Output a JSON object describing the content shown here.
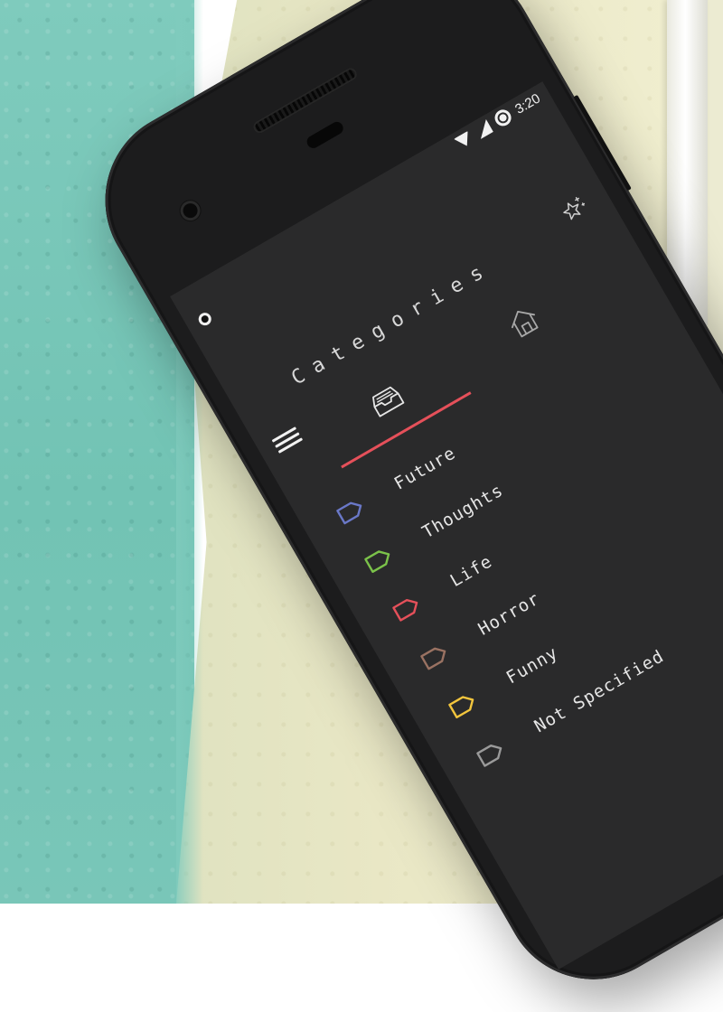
{
  "status_bar": {
    "time": "3:20",
    "icons": [
      "wifi-icon",
      "signal-icon",
      "target-icon"
    ]
  },
  "header": {
    "title": "Categories",
    "notification_icon": "circle-dot-icon",
    "magic_icon": "magic-star-icon",
    "menu_icon": "hamburger-menu-icon"
  },
  "tabs": [
    {
      "icon": "inbox-icon",
      "active": true
    },
    {
      "icon": "home-icon",
      "active": false
    }
  ],
  "categories": [
    {
      "label": "Future",
      "color": "#6a78c8"
    },
    {
      "label": "Thoughts",
      "color": "#7bc24a"
    },
    {
      "label": "Life",
      "color": "#e5505a"
    },
    {
      "label": "Horror",
      "color": "#9a7262"
    },
    {
      "label": "Funny",
      "color": "#f2c53d"
    },
    {
      "label": "Not Specified",
      "color": "#9a9a9a"
    }
  ],
  "colors": {
    "screen_bg": "#2a2a2b",
    "accent": "#e5505a",
    "text": "#e6e6e6"
  }
}
